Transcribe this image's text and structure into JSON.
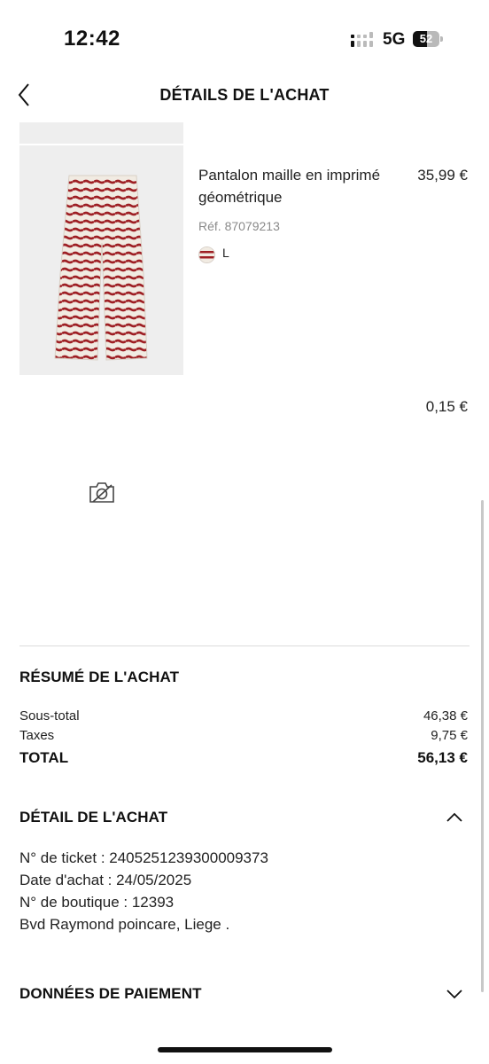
{
  "status_bar": {
    "time": "12:42",
    "network": "5G",
    "battery_level": "52",
    "battery_fraction": 0.52
  },
  "header": {
    "title": "DÉTAILS DE L'ACHAT",
    "back_icon": "chevron-left-icon"
  },
  "product": {
    "name": "Pantalon maille en imprimé géométrique",
    "price": "35,99 €",
    "reference": "Réf. 87079213",
    "size": "L",
    "stripe_color": "#9e1f24",
    "base_color": "#f1ebe2",
    "image_bg": "#eeeeee"
  },
  "extra_fee": "0,15 €",
  "no_photo_icon": "no-photo-icon",
  "summary": {
    "title": "RÉSUMÉ DE L'ACHAT",
    "subtotal_label": "Sous-total",
    "subtotal_value": "46,38 €",
    "taxes_label": "Taxes",
    "taxes_value": "9,75 €",
    "total_label": "TOTAL",
    "total_value": "56,13 €"
  },
  "purchase_detail": {
    "title": "DÉTAIL DE L'ACHAT",
    "toggle_icon": "chevron-up-icon",
    "ticket": "N° de ticket : 2405251239300009373",
    "date": "Date d'achat : 24/05/2025",
    "store": "N° de boutique : 12393",
    "address": "Bvd Raymond poincare, Liege ."
  },
  "payment": {
    "title": "DONNÉES DE PAIEMENT",
    "toggle_icon": "chevron-down-icon"
  }
}
